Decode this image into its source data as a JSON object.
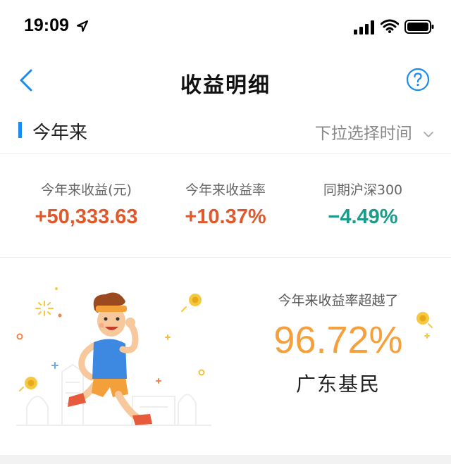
{
  "status_bar": {
    "time": "19:09"
  },
  "nav": {
    "title": "收益明细"
  },
  "filter": {
    "label": "今年来",
    "select_placeholder": "下拉选择时间"
  },
  "stats": [
    {
      "label": "今年来收益(元)",
      "value": "+50,333.63",
      "color": "#e0582b"
    },
    {
      "label": "今年来收益率",
      "value": "+10.37%",
      "color": "#e0582b"
    },
    {
      "label": "同期沪深300",
      "value": "−4.49%",
      "color": "#1b9b8a"
    }
  ],
  "beat": {
    "label": "今年来收益率超越了",
    "percent": "96.72%",
    "group": "广东基民"
  },
  "colors": {
    "accent": "#1a8cf0",
    "positive": "#e0582b",
    "negative": "#1b9b8a",
    "highlight": "#f5a03c"
  }
}
